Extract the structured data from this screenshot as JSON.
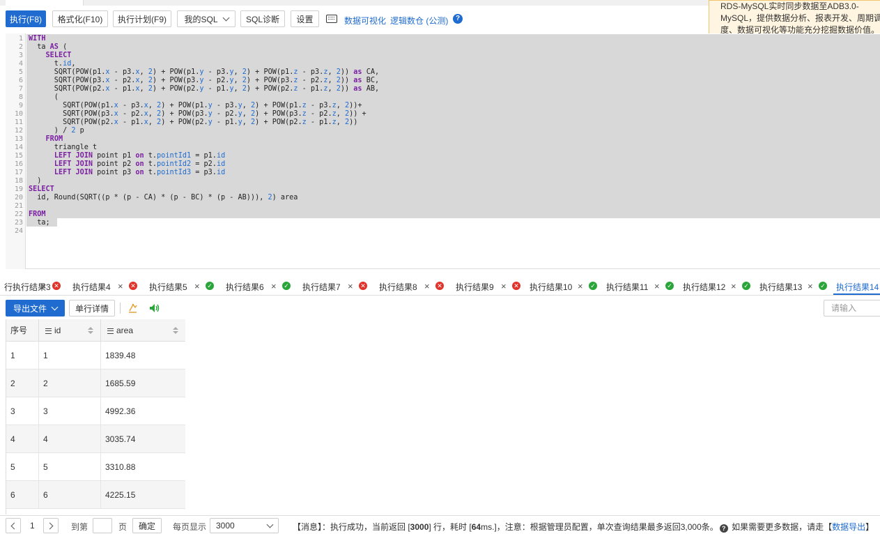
{
  "toolbar": {
    "execute": "执行(F8)",
    "format": "格式化(F10)",
    "plan": "执行计划(F9)",
    "mysql": "我的SQL",
    "diagnose": "SQL诊断",
    "settings": "设置",
    "link_visualize": "数据可视化",
    "link_warehouse": "逻辑数仓 (公测)"
  },
  "promo": {
    "line1": "RDS-MySQL实时同步数据至ADB3.0-",
    "line2": "MySQL，提供数据分析、报表开发、周期调",
    "line3": "度、数据可视化等功能充分挖掘数据价值。"
  },
  "editor": {
    "line_numbers": [
      "1",
      "2",
      "3",
      "4",
      "5",
      "6",
      "7",
      "8",
      "9",
      "10",
      "11",
      "12",
      "13",
      "14",
      "15",
      "16",
      "17",
      "18",
      "19",
      "20",
      "21",
      "22",
      "23",
      "24"
    ]
  },
  "result_tabs": [
    {
      "label": "行执行结果3",
      "status": "err"
    },
    {
      "label": "执行结果4",
      "status": "err"
    },
    {
      "label": "执行结果5",
      "status": "ok"
    },
    {
      "label": "执行结果6",
      "status": "ok"
    },
    {
      "label": "执行结果7",
      "status": "err"
    },
    {
      "label": "执行结果8",
      "status": "err"
    },
    {
      "label": "执行结果9",
      "status": "err"
    },
    {
      "label": "执行结果10",
      "status": "ok"
    },
    {
      "label": "执行结果11",
      "status": "ok"
    },
    {
      "label": "执行结果12",
      "status": "ok"
    },
    {
      "label": "执行结果13",
      "status": "ok"
    },
    {
      "label": "执行结果14",
      "status": "active"
    }
  ],
  "results": {
    "export_label": "导出文件",
    "detail_label": "单行详情",
    "search_placeholder": "请输入",
    "columns": [
      "序号",
      "id",
      "area"
    ],
    "rows": [
      [
        "1",
        "1",
        "1839.48"
      ],
      [
        "2",
        "2",
        "1685.59"
      ],
      [
        "3",
        "3",
        "4992.36"
      ],
      [
        "4",
        "4",
        "3035.74"
      ],
      [
        "5",
        "5",
        "3310.88"
      ],
      [
        "6",
        "6",
        "4225.15"
      ]
    ]
  },
  "pager": {
    "current_page": "1",
    "goto_label": "到第",
    "page_label": "页",
    "confirm_label": "确定",
    "per_page_label": "每页显示",
    "per_page_value": "3000",
    "msg_prefix": "【消息】：执行成功，当前返回 [",
    "msg_rows": "3000",
    "msg_mid": "] 行，耗时 [",
    "msg_time": "64",
    "msg_suffix": "ms.]，注意：根据管理员配置，单次查询结果最多返回3,000条。",
    "msg_more": "如果需要更多数据，请走【",
    "msg_link": "数据导出",
    "msg_end": "】"
  }
}
